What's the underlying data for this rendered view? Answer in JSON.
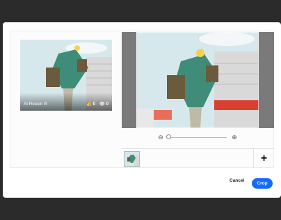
{
  "project_card": {
    "owner_name": "Al Rossin ®",
    "likes": "0",
    "views": "0",
    "like_icon": "thumbs-up-icon",
    "view_icon": "eye-icon"
  },
  "zoom": {
    "zoom_out_icon": "zoom-out-icon",
    "zoom_in_icon": "zoom-in-icon",
    "level": 0
  },
  "thumb_strip": {
    "add_label": "+"
  },
  "actions": {
    "cancel_label": "Cancel",
    "crop_label": "Crop"
  },
  "colors": {
    "accent": "#1769ff",
    "backdrop": "#2b2b2b",
    "editor_bg": "#7a7a7a"
  }
}
